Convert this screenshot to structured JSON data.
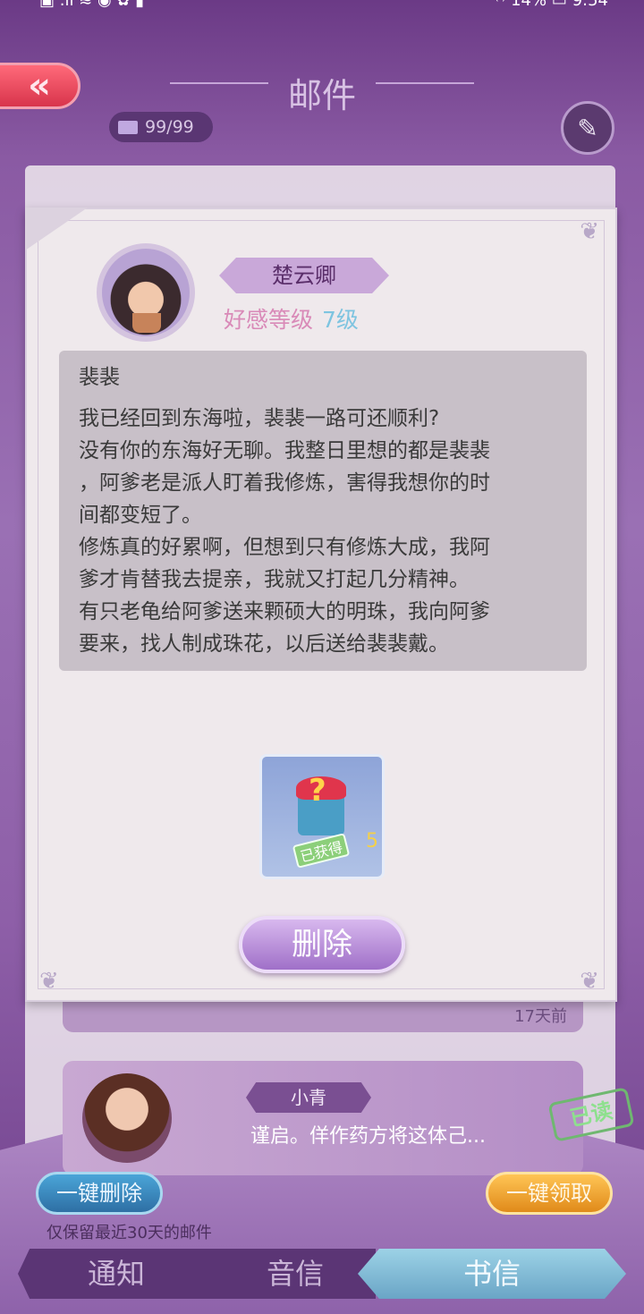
{
  "status": {
    "left_icons": "▣ .ıl ≋ ◉ ✿ ▮",
    "right": "⁽ᴵ⁾ 14% ▭ 9:54"
  },
  "header": {
    "back_label": "«",
    "title": "邮件",
    "mail_count": "99/99",
    "edit_icon": "edit-pencil-icon"
  },
  "letter": {
    "sender": "楚云卿",
    "favor_label": "好感等级",
    "favor_level": "7级",
    "salutation": "裴裴",
    "body": "我已经回到东海啦，裴裴一路可还顺利?\n没有你的东海好无聊。我整日里想的都是裴裴\n，阿爹老是派人盯着我修炼，害得我想你的时\n间都变短了。\n修炼真的好累啊，但想到只有修炼大成，我阿\n爹才肯替我去提亲，我就又打起几分精神。\n有只老龟给阿爹送来颗硕大的明珠，我向阿爹\n要来，找人制成珠花，以后送给裴裴戴。",
    "reward": {
      "icon": "mystery-gift-box-icon",
      "status": "已获得",
      "count": "5"
    },
    "delete_label": "删除"
  },
  "list": [
    {
      "time": "17天前"
    },
    {
      "name": "小青",
      "preview": "谨启。佯作药方将这体己...",
      "status": "已读"
    }
  ],
  "footer": {
    "delete_all": "一键删除",
    "claim_all": "一键领取",
    "note": "仅保留最近30天的邮件",
    "tabs": [
      "通知",
      "音信",
      "书信"
    ],
    "active_tab": "书信"
  },
  "colors": {
    "accent_purple": "#a070c8",
    "level_blue": "#7ec4e0",
    "favor_pink": "#d98ab8"
  }
}
